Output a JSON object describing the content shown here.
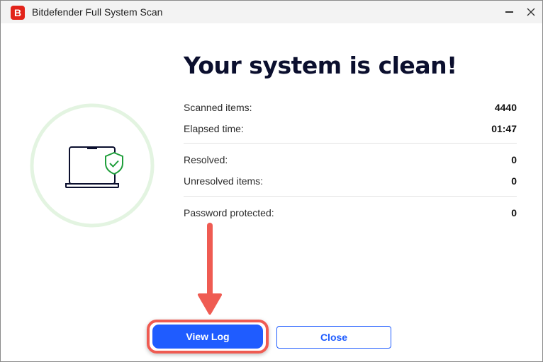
{
  "window": {
    "title": "Bitdefender Full System Scan",
    "logo_letter": "B"
  },
  "headline": "Your system is clean!",
  "stats": [
    {
      "label": "Scanned items:",
      "value": "4440"
    },
    {
      "label": "Elapsed time:",
      "value": "01:47"
    },
    {
      "label": "Resolved:",
      "value": "0"
    },
    {
      "label": "Unresolved items:",
      "value": "0"
    },
    {
      "label": "Password protected:",
      "value": "0"
    }
  ],
  "buttons": {
    "view_log": "View Log",
    "close": "Close"
  },
  "colors": {
    "brand_red": "#e2231a",
    "accent_blue": "#1f5cff",
    "success_green": "#1e9e3a",
    "ring_green": "#e3f4e1",
    "annotation_red": "#ef5b52"
  }
}
